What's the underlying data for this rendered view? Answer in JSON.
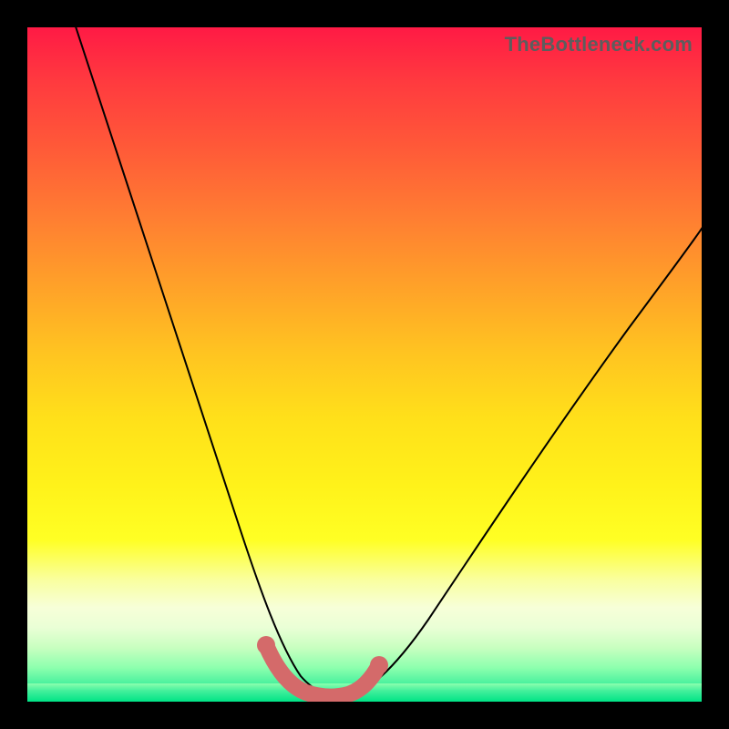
{
  "watermark": "TheBottleneck.com",
  "colors": {
    "frame": "#000000",
    "curve": "#000000",
    "highlight": "#d46a6a",
    "gradient_top": "#ff1a45",
    "gradient_mid": "#ffe01a",
    "gradient_bottom": "#00e386"
  },
  "chart_data": {
    "type": "line",
    "title": "",
    "xlabel": "",
    "ylabel": "",
    "xlim": [
      0,
      100
    ],
    "ylim": [
      0,
      100
    ],
    "grid": false,
    "legend": false,
    "series": [
      {
        "name": "bottleneck-curve",
        "x": [
          5,
          10,
          15,
          20,
          25,
          30,
          34,
          36,
          38,
          40,
          42,
          44,
          46,
          50,
          55,
          60,
          65,
          70,
          75,
          80,
          85,
          90,
          95,
          100
        ],
        "values": [
          100,
          88,
          76,
          63,
          50,
          37,
          24,
          18,
          12,
          7,
          4,
          2,
          2,
          3,
          6,
          11,
          17,
          24,
          31,
          39,
          47,
          54,
          60,
          65
        ]
      }
    ],
    "highlight": {
      "name": "optimal-range",
      "x": [
        34,
        36,
        38,
        40,
        42,
        44,
        46,
        48
      ],
      "values": [
        9,
        6,
        4,
        2.5,
        2,
        2,
        2.5,
        4
      ]
    }
  }
}
